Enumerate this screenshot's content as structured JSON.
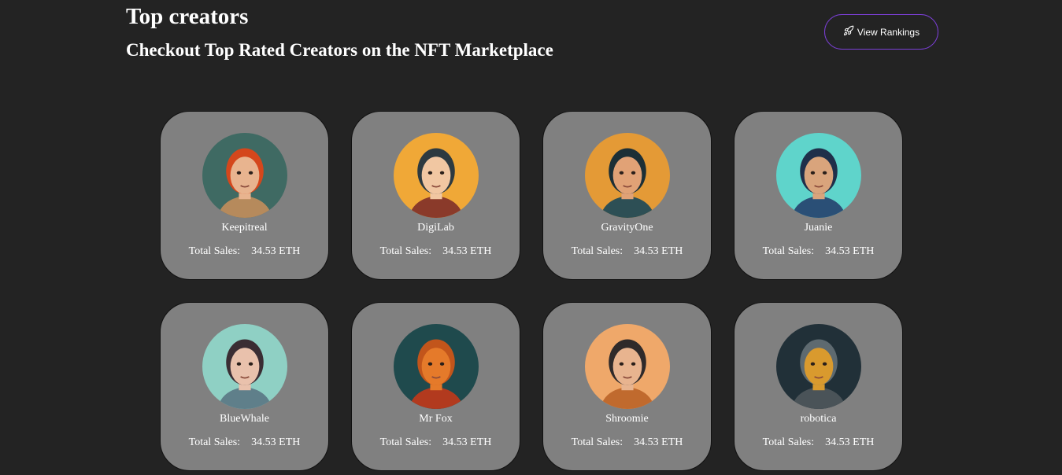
{
  "header": {
    "title": "Top creators",
    "subtitle": "Checkout Top Rated Creators on the NFT Marketplace",
    "rankings_button_label": "View Rankings",
    "rankings_button_icon": "rocket-icon"
  },
  "creators": [
    {
      "name": "Keepitreal",
      "sales_label": "Total Sales:",
      "sales_value": "34.53 ETH",
      "bg": "#3f6a63",
      "skin": "#e8b48f",
      "hair": "#d4471c",
      "shirt": "#b68a5c"
    },
    {
      "name": "DigiLab",
      "sales_label": "Total Sales:",
      "sales_value": "34.53 ETH",
      "bg": "#f0a837",
      "skin": "#f1c7a2",
      "hair": "#2d3a40",
      "shirt": "#8a3a2a"
    },
    {
      "name": "GravityOne",
      "sales_label": "Total Sales:",
      "sales_value": "34.53 ETH",
      "bg": "#e49a36",
      "skin": "#e1a276",
      "hair": "#1c2f36",
      "shirt": "#2d4f55"
    },
    {
      "name": "Juanie",
      "sales_label": "Total Sales:",
      "sales_value": "34.53 ETH",
      "bg": "#5fd4cb",
      "skin": "#d9a47c",
      "hair": "#1f2f4a",
      "shirt": "#2a4f76"
    },
    {
      "name": "BlueWhale",
      "sales_label": "Total Sales:",
      "sales_value": "34.53 ETH",
      "bg": "#8fd0c4",
      "skin": "#e9c1ac",
      "hair": "#3a2d33",
      "shirt": "#5f7f8a"
    },
    {
      "name": "Mr Fox",
      "sales_label": "Total Sales:",
      "sales_value": "34.53 ETH",
      "bg": "#1f4a4d",
      "skin": "#e57a2a",
      "hair": "#c2551b",
      "shirt": "#b23a1e"
    },
    {
      "name": "Shroomie",
      "sales_label": "Total Sales:",
      "sales_value": "34.53 ETH",
      "bg": "#efa86a",
      "skin": "#e8b48f",
      "hair": "#2f2a2a",
      "shirt": "#c06a2e"
    },
    {
      "name": "robotica",
      "sales_label": "Total Sales:",
      "sales_value": "34.53 ETH",
      "bg": "#213038",
      "skin": "#d99a2e",
      "hair": "#5e6a70",
      "shirt": "#4a5358"
    }
  ]
}
